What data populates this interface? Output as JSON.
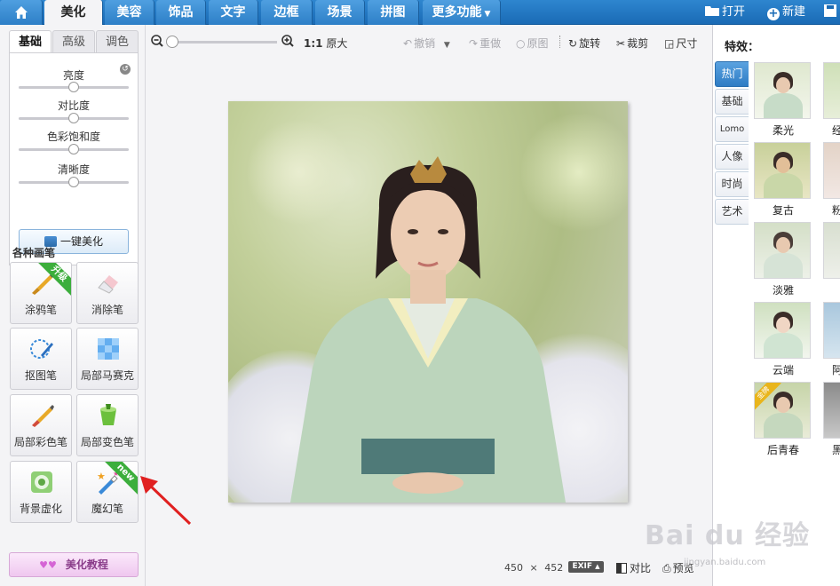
{
  "topbar": {
    "tabs": [
      {
        "label": "美化",
        "active": true
      },
      {
        "label": "美容",
        "active": false
      },
      {
        "label": "饰品",
        "active": false
      },
      {
        "label": "文字",
        "active": false
      },
      {
        "label": "边框",
        "active": false
      },
      {
        "label": "场景",
        "active": false
      },
      {
        "label": "拼图",
        "active": false
      },
      {
        "label": "更多功能",
        "active": false
      }
    ],
    "home_icon": "home-icon",
    "open_label": "打开",
    "new_label": "新建"
  },
  "left": {
    "subtabs": [
      "基础",
      "高级",
      "调色"
    ],
    "adjustments": [
      {
        "label": "亮度",
        "value": 0.5
      },
      {
        "label": "对比度",
        "value": 0.5
      },
      {
        "label": "色彩饱和度",
        "value": 0.5
      },
      {
        "label": "清晰度",
        "value": 0.5
      }
    ],
    "onekey_label": "一键美化",
    "brush_title": "各种画笔",
    "brushes": [
      {
        "label": "涂鸦笔",
        "badge": "升级",
        "icon": "paintbrush-icon"
      },
      {
        "label": "消除笔",
        "badge": "",
        "icon": "eraser-icon"
      },
      {
        "label": "抠图笔",
        "badge": "",
        "icon": "cutout-pen-icon"
      },
      {
        "label": "局部马赛克",
        "badge": "",
        "icon": "mosaic-icon"
      },
      {
        "label": "局部彩色笔",
        "badge": "",
        "icon": "color-brush-icon"
      },
      {
        "label": "局部变色笔",
        "badge": "",
        "icon": "color-change-icon"
      },
      {
        "label": "背景虚化",
        "badge": "",
        "icon": "blur-icon"
      },
      {
        "label": "魔幻笔",
        "badge": "new",
        "icon": "magic-pen-icon"
      }
    ],
    "tutorial_label": "美化教程"
  },
  "toolbar": {
    "ratio_bold": "1:1",
    "ratio_label": "原大",
    "undo": "撤销",
    "redo": "重做",
    "original": "原图",
    "rotate": "旋转",
    "crop": "裁剪",
    "size": "尺寸",
    "zoom": 0.0
  },
  "status": {
    "width": "450",
    "times": "×",
    "height": "452",
    "exif": "EXIF",
    "compare": "对比",
    "preview": "预览"
  },
  "right": {
    "title": "特效：",
    "categories": [
      "热门",
      "基础",
      "Lomo",
      "人像",
      "时尚",
      "艺术"
    ],
    "effects": [
      "柔光",
      "复古",
      "淡雅",
      "云端",
      "后青春"
    ],
    "partial_effects": [
      "经",
      "粉",
      "",
      "阿",
      "黑"
    ],
    "badge": "金牌"
  },
  "watermark": {
    "text": "Bai du 经验",
    "url": "jingyan.baidu.com"
  },
  "colors": {
    "accent": "#2e86cf",
    "arrow": "#e02020",
    "badge_green": "#3cae3c"
  }
}
